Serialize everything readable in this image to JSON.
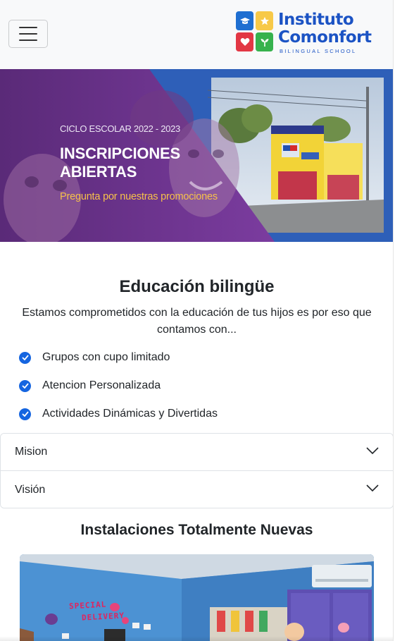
{
  "navbar": {
    "toggler_icon": "hamburger-menu-icon",
    "logo": {
      "line1": "Instituto",
      "line2": "Comonfort",
      "subtitle": "BILINGUAL SCHOOL",
      "colors": {
        "text": "#1b53c4",
        "blue": "#1f6fd1",
        "yellow": "#f7c948",
        "red": "#e23744",
        "green": "#37b24d"
      }
    }
  },
  "banner": {
    "cycle": "CICLO ESCOLAR 2022 - 2023",
    "title_line1": "INSCRIPCIONES",
    "title_line2": "ABIERTAS",
    "promo": "Pregunta por nuestras promociones",
    "colors": {
      "purple": "#6b2f8f",
      "blue": "#2e5fb8",
      "promo": "#f6c14a"
    }
  },
  "intro": {
    "title": "Educación bilingüe",
    "text": "Estamos comprometidos con la educación de tus hijos es por eso que contamos con...",
    "features": [
      {
        "label": "Grupos con cupo limitado",
        "icon": "check-circle-icon"
      },
      {
        "label": "Atencion Personalizada",
        "icon": "check-circle-icon"
      },
      {
        "label": "Actividades Dinámicas y Divertidas",
        "icon": "check-circle-icon"
      }
    ],
    "check_color": "#1565e0"
  },
  "accordion": {
    "items": [
      {
        "label": "Mision",
        "icon": "chevron-down-icon"
      },
      {
        "label": "Visión",
        "icon": "chevron-down-icon"
      }
    ]
  },
  "facilities": {
    "title": "Instalaciones Totalmente Nuevas",
    "photo_text_line1": "SPECIAL",
    "photo_text_line2": "DELIVERY"
  }
}
